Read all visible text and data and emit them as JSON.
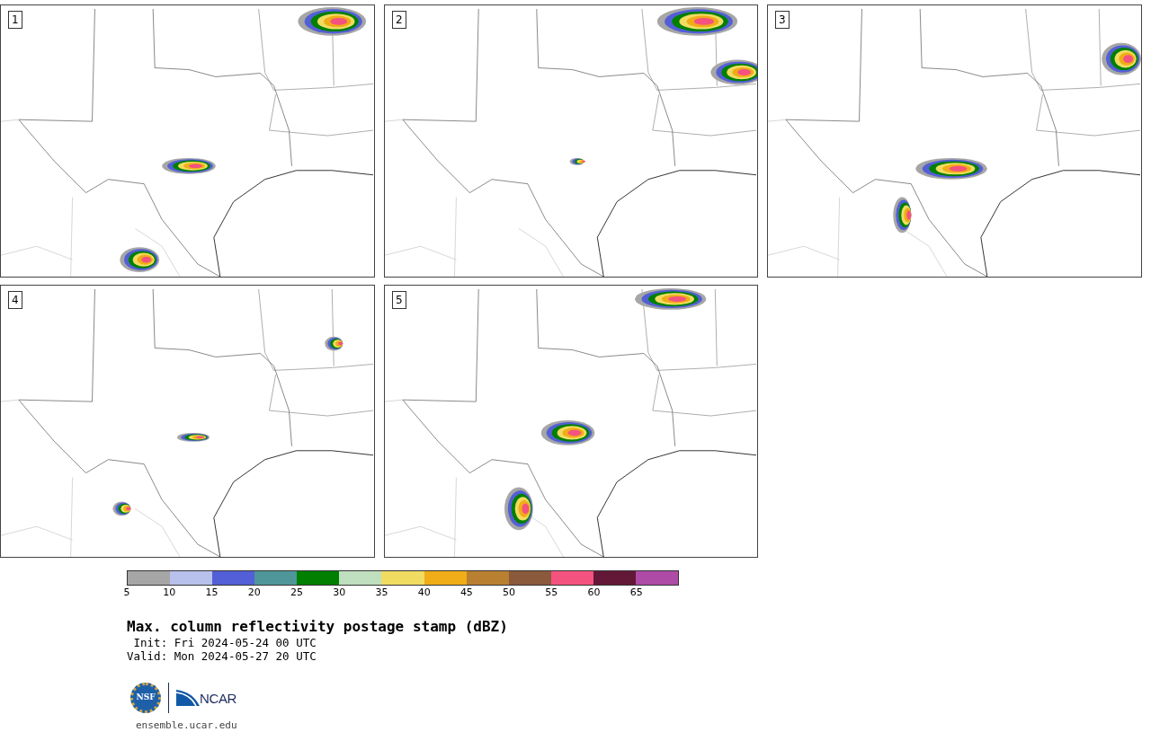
{
  "panels": [
    {
      "label": "1"
    },
    {
      "label": "2"
    },
    {
      "label": "3"
    },
    {
      "label": "4"
    },
    {
      "label": "5"
    }
  ],
  "colorbar": {
    "segments": [
      {
        "tick": "5",
        "color": "#a6a6a6"
      },
      {
        "tick": "10",
        "color": "#b8c1ec"
      },
      {
        "tick": "15",
        "color": "#535fd6"
      },
      {
        "tick": "20",
        "color": "#4e9699"
      },
      {
        "tick": "25",
        "color": "#007f00"
      },
      {
        "tick": "30",
        "color": "#bfdfbf"
      },
      {
        "tick": "35",
        "color": "#f0dc61"
      },
      {
        "tick": "40",
        "color": "#f0ad17"
      },
      {
        "tick": "45",
        "color": "#b88030"
      },
      {
        "tick": "50",
        "color": "#8b5a3c"
      },
      {
        "tick": "55",
        "color": "#f4527f"
      },
      {
        "tick": "60",
        "color": "#641838"
      },
      {
        "tick": "65",
        "color": "#ae4ba6"
      }
    ]
  },
  "title": "Max. column reflectivity postage stamp (dBZ)",
  "init": " Init: Fri 2024-05-24 00 UTC",
  "valid": "Valid: Mon 2024-05-27 20 UTC",
  "logos": {
    "nsf": "NSF",
    "ncar": "NCAR"
  },
  "url": "ensemble.ucar.edu"
}
